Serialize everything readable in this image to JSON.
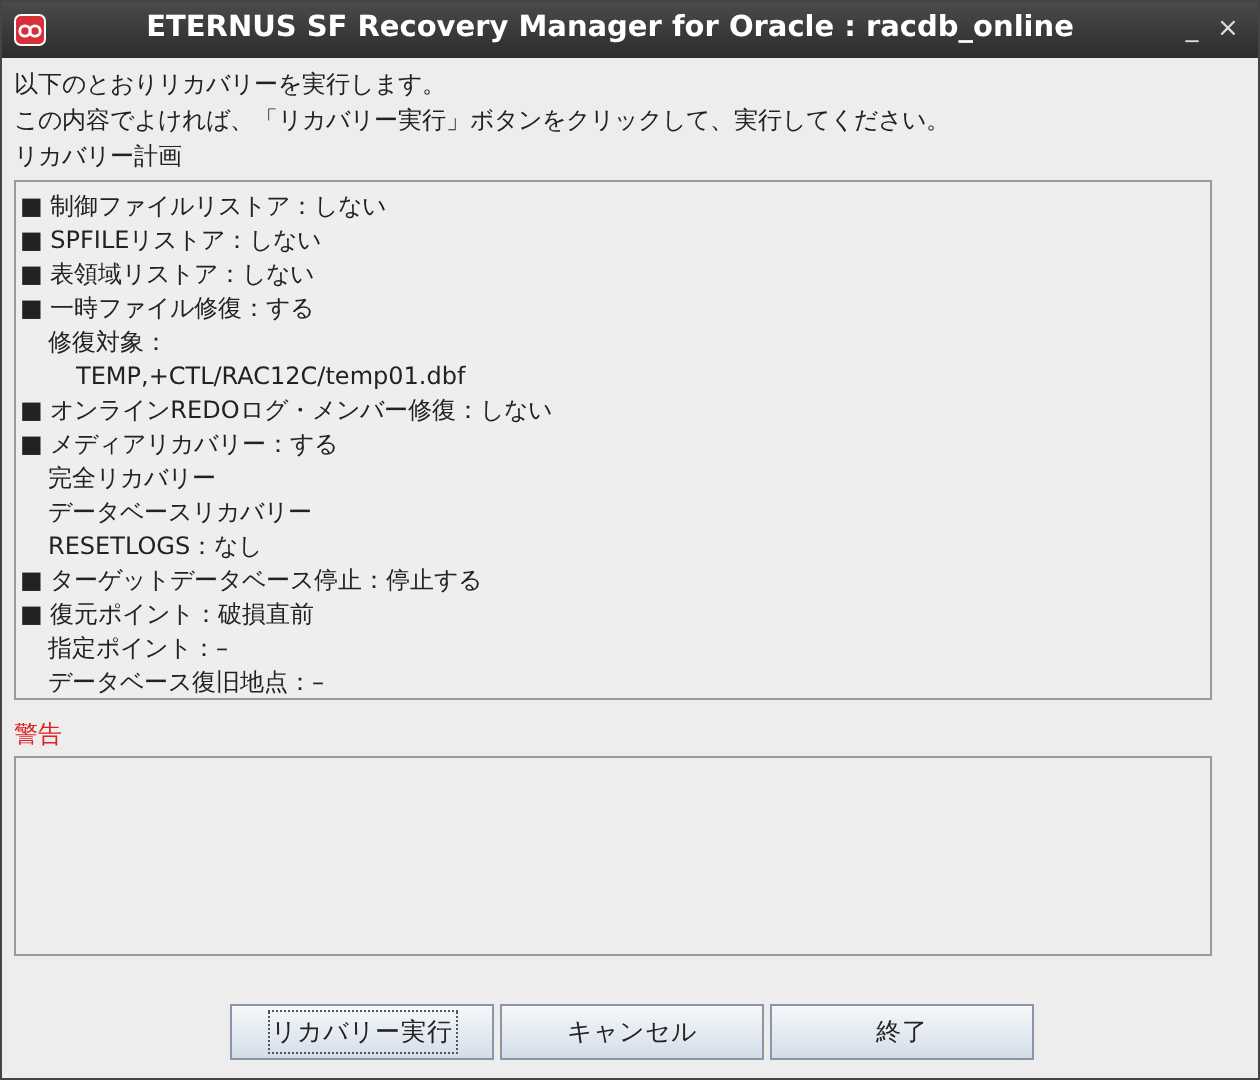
{
  "window": {
    "title": "ETERNUS SF Recovery Manager for Oracle : racdb_online",
    "controls": [
      "_",
      "×"
    ]
  },
  "intro": [
    "以下のとおりリカバリーを実行します。",
    "この内容でよければ、「リカバリー実行」ボタンをクリックして、実行してください。"
  ],
  "plan_label": "リカバリー計画",
  "plan": [
    {
      "text": "■ 制御ファイルリストア：しない"
    },
    {
      "text": "■ SPFILEリストア：しない"
    },
    {
      "text": "■ 表領域リストア：しない"
    },
    {
      "text": "■ 一時ファイル修復：する",
      "children": [
        {
          "text": "修復対象：",
          "children": [
            {
              "text": "TEMP,+CTL/RAC12C/temp01.dbf"
            }
          ]
        }
      ]
    },
    {
      "text": "■ オンラインREDOログ・メンバー修復：しない"
    },
    {
      "text": "■ メディアリカバリー：する",
      "children": [
        {
          "text": "完全リカバリー"
        },
        {
          "text": "データベースリカバリー"
        },
        {
          "text": "RESETLOGS：なし"
        }
      ]
    },
    {
      "text": "■ ターゲットデータベース停止：停止する"
    },
    {
      "text": "■ 復元ポイント：破損直前",
      "children": [
        {
          "text": "指定ポイント：–"
        },
        {
          "text": "データベース復旧地点：–"
        }
      ]
    }
  ],
  "warning_label": "警告",
  "buttons": [
    {
      "label": "リカバリー実行",
      "focused": true
    },
    {
      "label": "キャンセル",
      "focused": false
    },
    {
      "label": "終了",
      "focused": false
    }
  ]
}
